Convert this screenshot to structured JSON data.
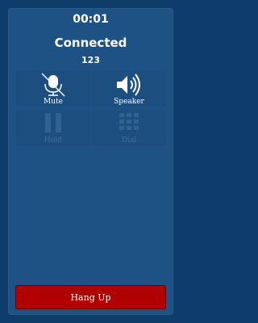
{
  "call": {
    "timer": "00:01",
    "status": "Connected",
    "number": "123"
  },
  "controls": [
    {
      "label": "Mute",
      "icon": "muted-microphone-icon",
      "enabled": true
    },
    {
      "label": "Speaker",
      "icon": "speaker-icon",
      "enabled": true
    },
    {
      "label": "Hold",
      "icon": "pause-icon",
      "enabled": false
    },
    {
      "label": "Dial",
      "icon": "dialpad-icon",
      "enabled": false
    }
  ],
  "hangup": {
    "label": "Hang Up"
  },
  "colors": {
    "background": "#0f3d6b",
    "panel": "#1e5284",
    "hangup": "#b00000",
    "disabled_text": "#3f6f9c"
  }
}
